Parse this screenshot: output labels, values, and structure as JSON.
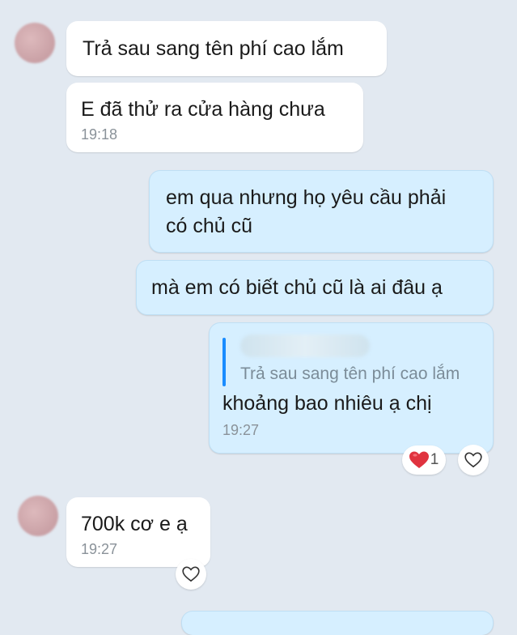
{
  "messages": [
    {
      "text": "Trả sau sang tên phí cao lắm"
    },
    {
      "text": "E đã thử ra cửa hàng chưa",
      "time": "19:18"
    },
    {
      "text": "em qua nhưng họ yêu cầu phải\ncó chủ cũ"
    },
    {
      "text": "mà em có biết chủ cũ là ai đâu ạ"
    },
    {
      "quoted_text": "Trả sau sang tên phí cao lắm",
      "text": "khoảng bao nhiêu ạ chị",
      "time": "19:27",
      "reaction_count": "1"
    },
    {
      "text": "700k cơ e ạ",
      "time": "19:27"
    }
  ],
  "colors": {
    "background": "#e2e9f1",
    "incoming": "#ffffff",
    "outgoing": "#d6efff",
    "accent": "#1a8cff",
    "heart": "#e0333f"
  },
  "icons": [
    "heart-outline-icon",
    "red-heart-icon"
  ]
}
